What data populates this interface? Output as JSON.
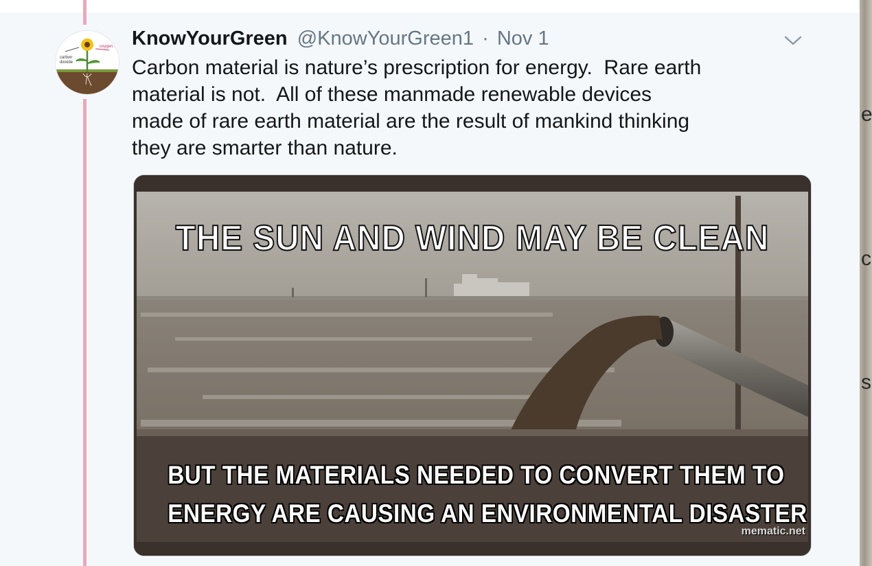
{
  "tweet": {
    "display_name": "KnowYourGreen",
    "handle": "@KnowYourGreen1",
    "separator": "·",
    "date": "Nov 1",
    "text": "Carbon material is nature’s prescription for energy.  Rare earth\nmaterial is not.  All of these manmade renewable devices\nmade of rare earth material are the result of mankind thinking\nthey are smarter than nature.",
    "more_icon": "chevron-down-icon"
  },
  "avatar": {
    "labels": [
      "carbon dioxide",
      "oxygen"
    ]
  },
  "meme": {
    "top_text": "THE SUN AND WIND MAY BE CLEAN",
    "bottom_line_1": "BUT THE MATERIALS NEEDED TO CONVERT THEM TO",
    "bottom_line_2": "ENERGY ARE CAUSING AN ENVIRONMENTAL DISASTER",
    "watermark": "mematic.net"
  },
  "colors": {
    "thread_line": "#e8a9b8",
    "background": "#f5f8fa",
    "handle_gray": "#657786"
  }
}
